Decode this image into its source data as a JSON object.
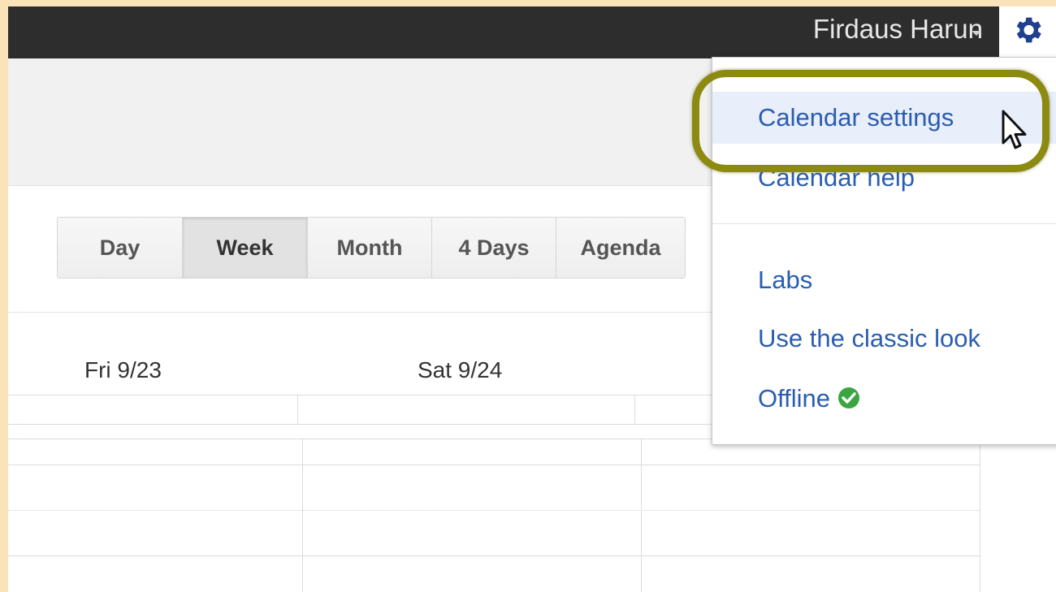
{
  "header": {
    "user_name": "Firdaus Harun"
  },
  "views": {
    "buttons": [
      {
        "label": "Day",
        "active": false
      },
      {
        "label": "Week",
        "active": true
      },
      {
        "label": "Month",
        "active": false
      },
      {
        "label": "4 Days",
        "active": false
      },
      {
        "label": "Agenda",
        "active": false
      }
    ]
  },
  "calendar": {
    "day_headers": [
      "Fri 9/23",
      "Sat 9/24"
    ]
  },
  "settings_menu": {
    "items": [
      {
        "label": "Calendar settings",
        "hovered": true
      },
      {
        "label": "Calendar help"
      },
      {
        "label": "Labs"
      },
      {
        "label": "Use the classic look"
      },
      {
        "label": "Offline",
        "status_icon": "check-circle-icon"
      }
    ]
  },
  "colors": {
    "accent_link": "#2a5db0",
    "highlight_ring": "#8c8a10",
    "offline_ok": "#3aa541",
    "topbar": "#2d2d2d"
  }
}
